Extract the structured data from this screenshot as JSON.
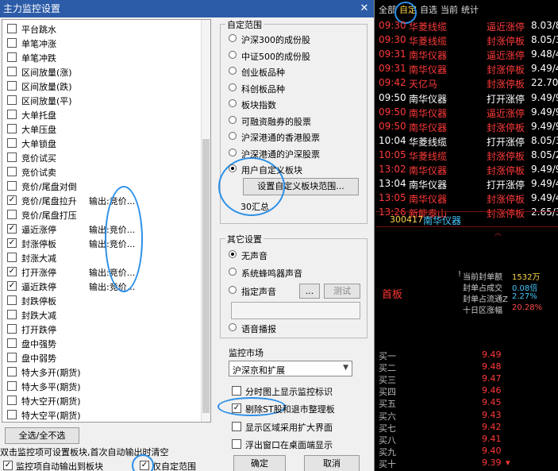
{
  "dialog": {
    "title": "主力监控设置",
    "close": "✕",
    "list_items": [
      {
        "label": "平台跳水",
        "checked": false,
        "output": ""
      },
      {
        "label": "单笔冲涨",
        "checked": false,
        "output": ""
      },
      {
        "label": "单笔冲跌",
        "checked": false,
        "output": ""
      },
      {
        "label": "区间放量(涨)",
        "checked": false,
        "output": ""
      },
      {
        "label": "区间放量(跌)",
        "checked": false,
        "output": ""
      },
      {
        "label": "区间放量(平)",
        "checked": false,
        "output": ""
      },
      {
        "label": "大单托盘",
        "checked": false,
        "output": ""
      },
      {
        "label": "大单压盘",
        "checked": false,
        "output": ""
      },
      {
        "label": "大单锁盘",
        "checked": false,
        "output": ""
      },
      {
        "label": "竞价试买",
        "checked": false,
        "output": ""
      },
      {
        "label": "竞价试卖",
        "checked": false,
        "output": ""
      },
      {
        "label": "竞价/尾盘对倒",
        "checked": false,
        "output": ""
      },
      {
        "label": "竞价/尾盘拉升",
        "checked": true,
        "output": "输出:竞价..."
      },
      {
        "label": "竞价/尾盘打压",
        "checked": false,
        "output": ""
      },
      {
        "label": "逼近涨停",
        "checked": true,
        "output": "输出:竞价..."
      },
      {
        "label": "封涨停板",
        "checked": true,
        "output": "输出:竞价..."
      },
      {
        "label": "封涨大减",
        "checked": false,
        "output": ""
      },
      {
        "label": "打开涨停",
        "checked": true,
        "output": "输出:竞价..."
      },
      {
        "label": "逼近跌停",
        "checked": true,
        "output": "输出:竞价..."
      },
      {
        "label": "封跌停板",
        "checked": false,
        "output": ""
      },
      {
        "label": "封跌大减",
        "checked": false,
        "output": ""
      },
      {
        "label": "打开跌停",
        "checked": false,
        "output": ""
      },
      {
        "label": "盘中强势",
        "checked": false,
        "output": ""
      },
      {
        "label": "盘中弱势",
        "checked": false,
        "output": ""
      },
      {
        "label": "特大多开(期货)",
        "checked": false,
        "output": ""
      },
      {
        "label": "特大多平(期货)",
        "checked": false,
        "output": ""
      },
      {
        "label": "特大空开(期货)",
        "checked": false,
        "output": ""
      },
      {
        "label": "特大空平(期货)",
        "checked": false,
        "output": ""
      },
      {
        "label": "多头大涨(单股)",
        "checked": false,
        "output": ""
      }
    ],
    "select_all": "全选/全不选",
    "note": "双击监控项可设置板块,首次自动输出时清空",
    "auto_output_label": "监控项自动输出到板块",
    "auto_output_checked": true,
    "custom_range_label": "仅自定范围",
    "custom_range_checked": true,
    "range_group": {
      "title": "自定范围",
      "options": [
        "沪深300的成份股",
        "中证500的成份股",
        "创业板品种",
        "科创板品种",
        "板块指数",
        "可融资融券的股票",
        "沪深港通的香港股票",
        "沪深港通的沪深股票",
        "用户自定义板块"
      ],
      "selected": 8,
      "setup_button": "设置自定义板块范围...",
      "summary": "30汇总"
    },
    "other_group": {
      "title": "其它设置",
      "options": [
        "无声音",
        "系统蜂鸣器声音",
        "指定声音",
        "语音播报"
      ],
      "selected": 0,
      "browse": "...",
      "test": "测试"
    },
    "market": {
      "label": "监控市场",
      "value": "沪深京和扩展",
      "arrow": "▼"
    },
    "checks": [
      {
        "label": "分时图上显示监控标识",
        "checked": false
      },
      {
        "label": "剔除ST股和退市整理板",
        "checked": true
      },
      {
        "label": "显示区域采用扩大界面",
        "checked": false
      },
      {
        "label": "浮出窗口在桌面端显示",
        "checked": false
      }
    ],
    "ok": "确定",
    "cancel": "取消"
  },
  "panel": {
    "tabs": [
      "全部",
      "自定",
      "自选",
      "当前",
      "统计"
    ],
    "active_tab": 1,
    "rows": [
      {
        "time": "09:30",
        "name": "华菱线缆",
        "event": "逼近涨停",
        "value": "8.03/8",
        "red_time": true
      },
      {
        "time": "09:30",
        "name": "华菱线缆",
        "event": "封涨停板",
        "value": "8.05/3",
        "red_time": true
      },
      {
        "time": "09:31",
        "name": "南华仪器",
        "event": "逼近涨停",
        "value": "9.48/4",
        "red_time": true
      },
      {
        "time": "09:31",
        "name": "南华仪器",
        "event": "封涨停板",
        "value": "9.49/4",
        "red_time": true
      },
      {
        "time": "09:42",
        "name": "天亿马",
        "event": "封涨停板",
        "value": "22.70",
        "red_time": true
      },
      {
        "time": "09:50",
        "name": "南华仪器",
        "event": "打开涨停",
        "value": "9.49/9",
        "red_time": false
      },
      {
        "time": "09:50",
        "name": "南华仪器",
        "event": "逼近涨停",
        "value": "9.49/9",
        "red_time": true
      },
      {
        "time": "09:50",
        "name": "南华仪器",
        "event": "封涨停板",
        "value": "9.49/9",
        "red_time": true
      },
      {
        "time": "10:04",
        "name": "华菱线缆",
        "event": "打开涨停",
        "value": "8.05/3",
        "red_time": false
      },
      {
        "time": "10:05",
        "name": "华菱线缆",
        "event": "封涨停板",
        "value": "8.05/2",
        "red_time": true
      },
      {
        "time": "13:02",
        "name": "南华仪器",
        "event": "封涨停板",
        "value": "9.49/9",
        "red_time": true
      },
      {
        "time": "13:04",
        "name": "南华仪器",
        "event": "打开涨停",
        "value": "9.49/4",
        "red_time": false
      },
      {
        "time": "13:05",
        "name": "南华仪器",
        "event": "封涨停板",
        "value": "9.49/4",
        "red_time": true
      },
      {
        "time": "13:26",
        "name": "新能泰山",
        "event": "封涨停板",
        "value": "2.65/3",
        "red_time": true
      }
    ],
    "selected": {
      "code": "300417",
      "name": "南华仪器"
    },
    "up_mark": "︿",
    "info": [
      {
        "label": "当前封单额",
        "value": "1532万",
        "prefix": "!"
      },
      {
        "label": "封单占成交",
        "value": "0.08倍",
        "prefix": ""
      },
      {
        "label": "封单占流通Z",
        "value": "2.27%",
        "prefix": ""
      },
      {
        "label": "十日区涨幅",
        "value": "20.28%",
        "prefix": ""
      }
    ],
    "board": "首板",
    "orderbook": [
      {
        "label": "买一",
        "value": "9.49"
      },
      {
        "label": "买二",
        "value": "9.48"
      },
      {
        "label": "买三",
        "value": "9.47"
      },
      {
        "label": "买四",
        "value": "9.46"
      },
      {
        "label": "买五",
        "value": "9.45"
      },
      {
        "label": "买六",
        "value": "9.43"
      },
      {
        "label": "买七",
        "value": "9.42"
      },
      {
        "label": "买八",
        "value": "9.41"
      },
      {
        "label": "买九",
        "value": "9.40"
      },
      {
        "label": "买十",
        "value": "9.39"
      }
    ],
    "last_arrow": "▾",
    "colors": {
      "red": "#ff3a3a",
      "white": "#ffffff",
      "yellow": "#ffd54a",
      "cyan": "#45c8ff",
      "code": "#ffd54a"
    }
  }
}
